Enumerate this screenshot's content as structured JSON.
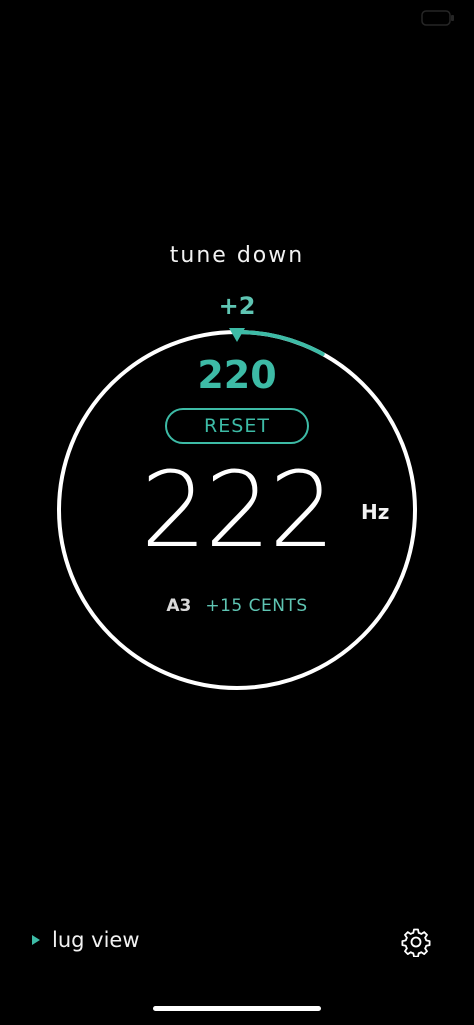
{
  "tuner": {
    "instruction": "tune down",
    "offset": "+2",
    "target_frequency": "220",
    "reset_label": "RESET",
    "current_frequency": "222",
    "unit": "Hz",
    "note": "A3",
    "cents": "+15 CENTS",
    "pitch_arc_fraction": 0.1
  },
  "footer": {
    "lug_view_label": "lug view"
  },
  "icons": {
    "status": "battery-icon",
    "lug": "play-icon",
    "settings": "gear-icon"
  },
  "colors": {
    "accent": "#3dbba6",
    "background": "#000000",
    "text": "#ffffff"
  }
}
